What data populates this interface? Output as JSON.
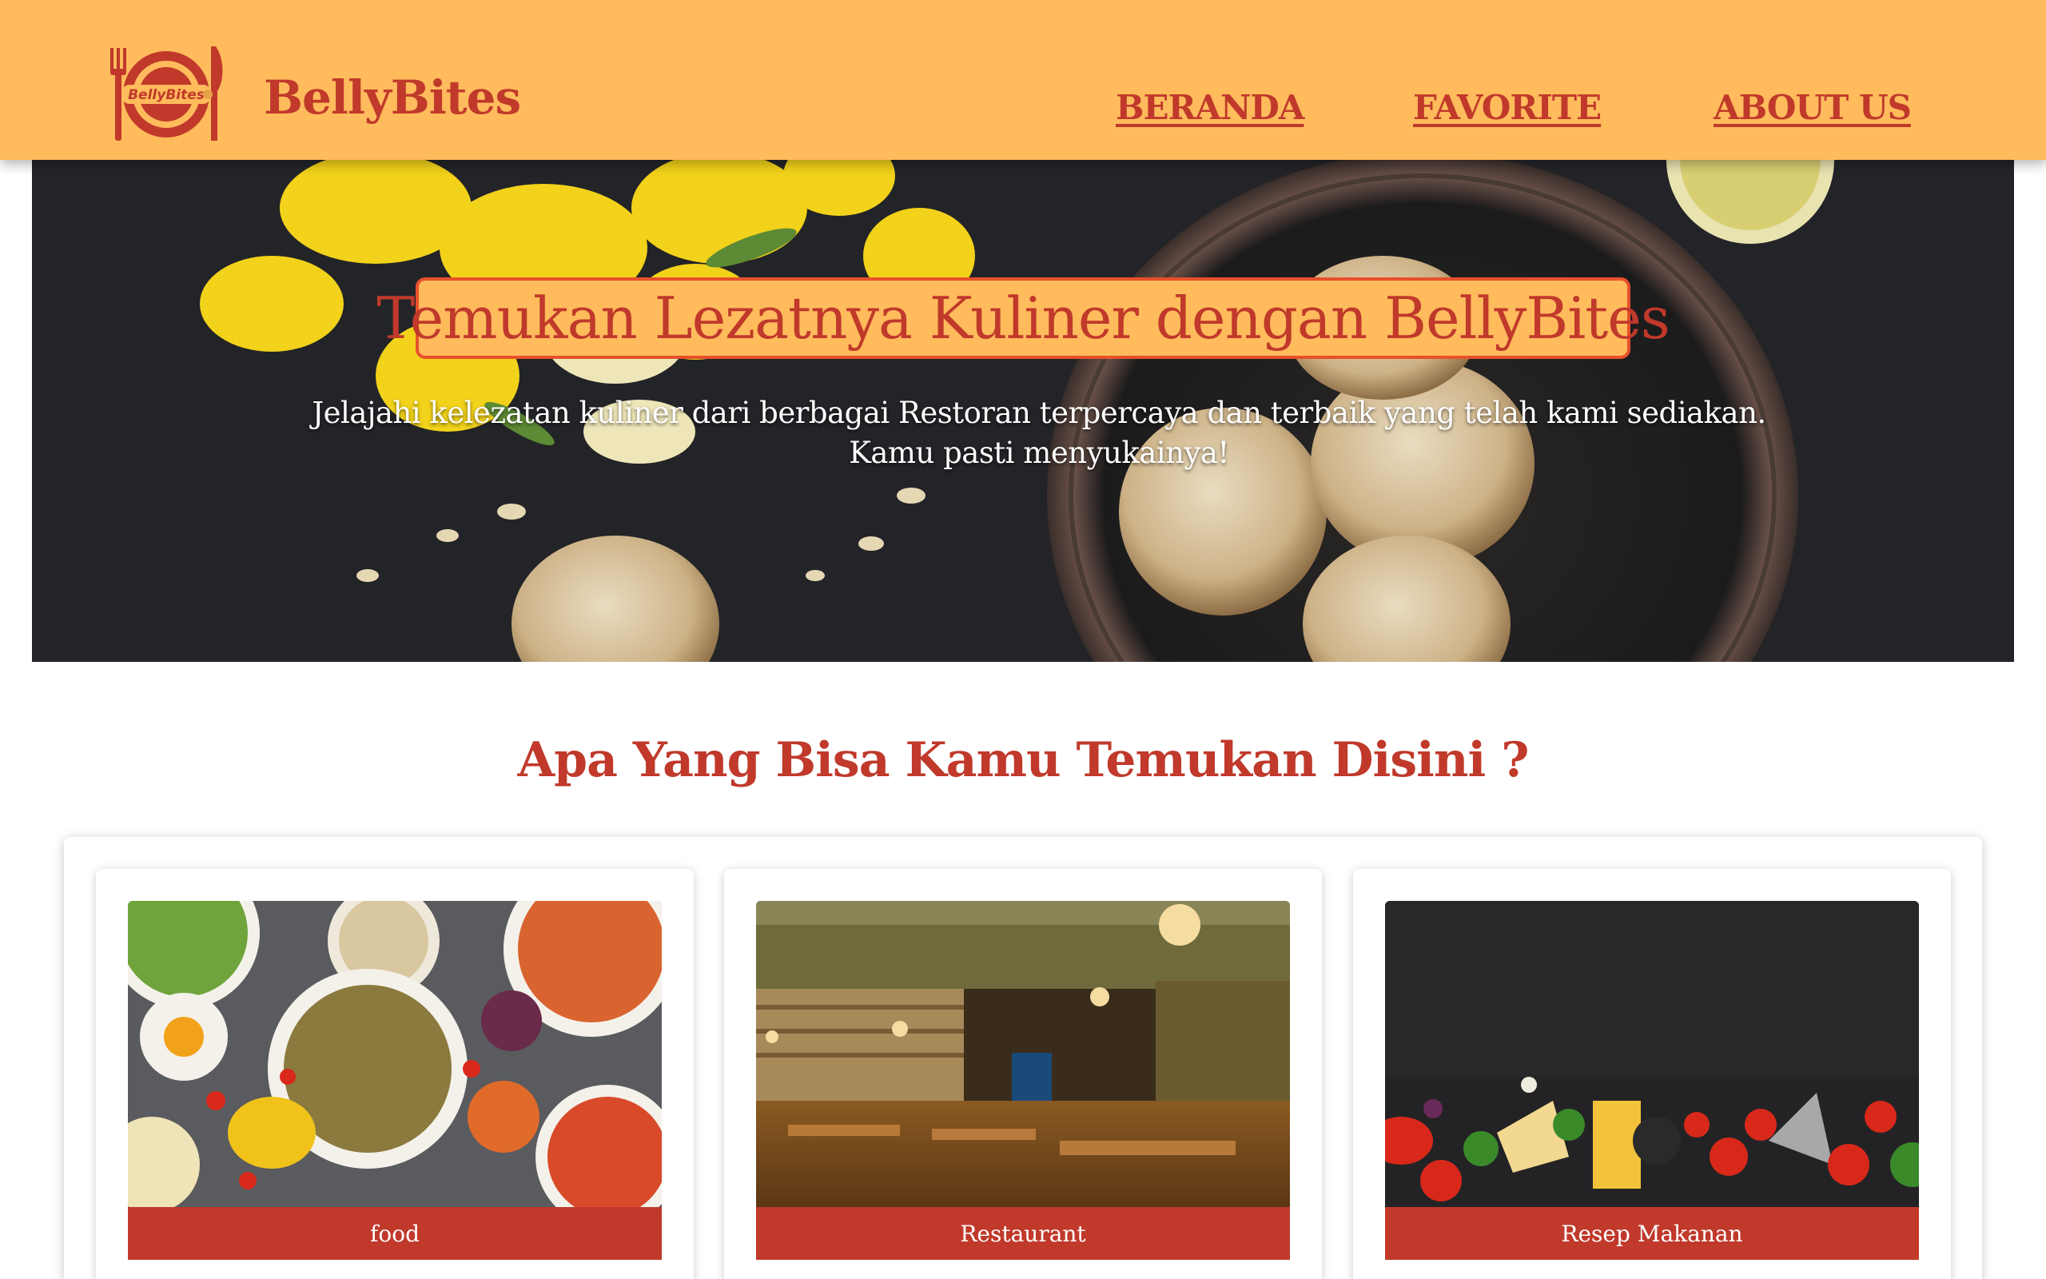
{
  "header": {
    "logo_text": "BellyBites",
    "brand": "BellyBites",
    "nav": [
      "BERANDA",
      "FAVORITE",
      "ABOUT US"
    ]
  },
  "hero": {
    "title": "Temukan Lezatnya Kuliner dengan BellyBites",
    "subtitle_line1": "Jelajahi kelezatan kuliner dari berbagai Restoran terpercaya dan terbaik yang telah kami sediakan.",
    "subtitle_line2": "Kamu pasti menyukainya!"
  },
  "section": {
    "title": "Apa Yang Bisa Kamu Temukan Disini ?"
  },
  "cards": [
    {
      "label": "food"
    },
    {
      "label": "Restaurant"
    },
    {
      "label": "Resep Makanan"
    }
  ],
  "colors": {
    "header_bg": "#ffbb5c",
    "accent": "#c0392b",
    "hero_title_border": "#e8512a"
  }
}
